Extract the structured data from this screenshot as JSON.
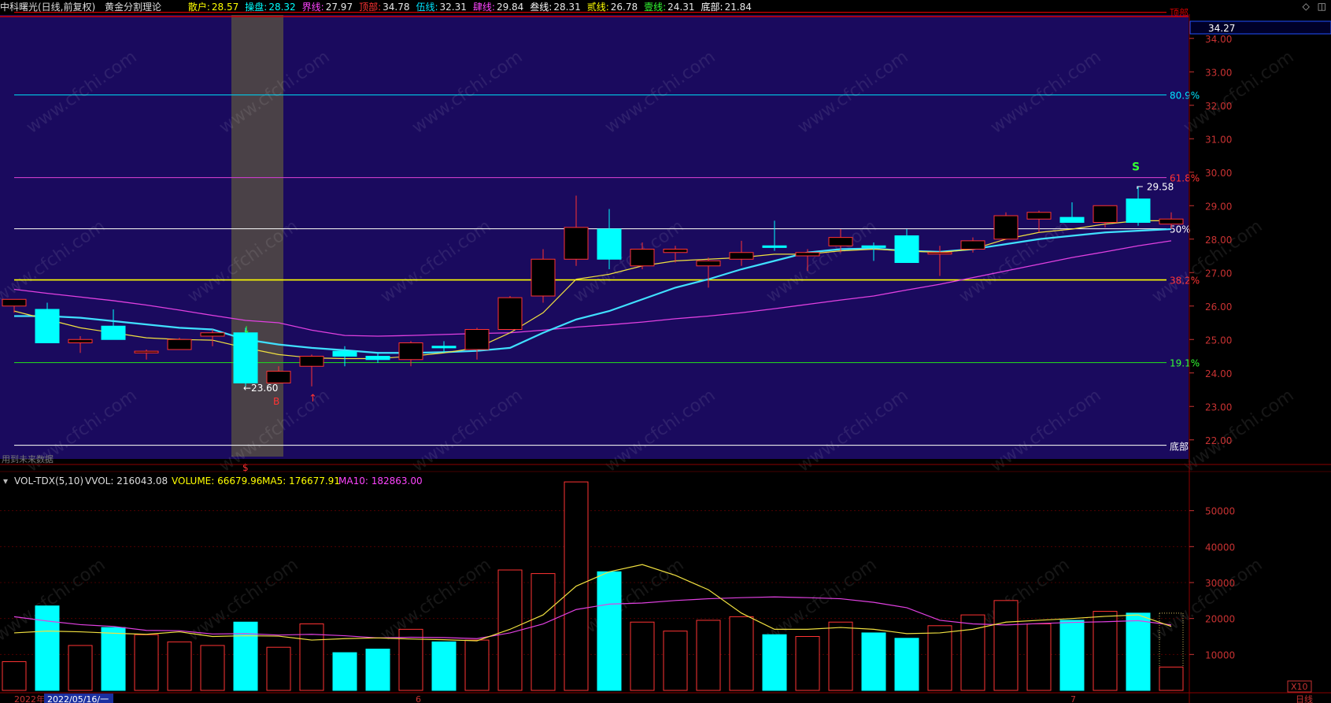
{
  "header": {
    "stock_name": "中科曙光(日线,前复权)",
    "indicator_name": "黄金分割理论",
    "params": [
      {
        "label": "散户:",
        "value": "28.57",
        "color": "#ffff00"
      },
      {
        "label": "操盘:",
        "value": "28.32",
        "color": "#00ffff"
      },
      {
        "label": "界线:",
        "value": "27.97",
        "color": "#ff44ff"
      },
      {
        "label": "顶部:",
        "value": "34.78",
        "color": "#ff3333"
      },
      {
        "label": "伍线:",
        "value": "32.31",
        "color": "#00e5ff"
      },
      {
        "label": "肆线:",
        "value": "29.84",
        "color": "#ff44ff"
      },
      {
        "label": "叁线:",
        "value": "28.31",
        "color": "#ffffff"
      },
      {
        "label": "贰线:",
        "value": "26.78",
        "color": "#ffff00"
      },
      {
        "label": "壹线:",
        "value": "24.31",
        "color": "#33ff33"
      },
      {
        "label": "底部:",
        "value": "21.84",
        "color": "#ffffff"
      }
    ],
    "top_right_icons": [
      "diamond-icon",
      "window-icon"
    ]
  },
  "price_axis": {
    "current": "34.27",
    "ticks": [
      "34.00",
      "33.00",
      "32.00",
      "31.00",
      "30.00",
      "29.00",
      "28.00",
      "27.00",
      "26.00",
      "25.00",
      "24.00",
      "23.00",
      "22.00"
    ]
  },
  "fib_levels": [
    {
      "label": "顶部",
      "price": 34.78,
      "color": "#d40000",
      "label_color": "#d40000"
    },
    {
      "label": "80.9%",
      "price": 32.31,
      "color": "#00c8e6",
      "label_color": "#00e5ff"
    },
    {
      "label": "61.8%",
      "price": 29.84,
      "color": "#c83cc8",
      "label_color": "#ff3333"
    },
    {
      "label": "50%",
      "price": 28.31,
      "color": "#e8e8e8",
      "label_color": "#ffffff"
    },
    {
      "label": "38.2%",
      "price": 26.78,
      "color": "#ffff00",
      "label_color": "#ff3333"
    },
    {
      "label": "19.1%",
      "price": 24.31,
      "color": "#22cc22",
      "label_color": "#33ff33"
    },
    {
      "label": "底部",
      "price": 21.84,
      "color": "#e8e8e8",
      "label_color": "#ffffff"
    }
  ],
  "chart_data": {
    "type": "candlestick",
    "price_range": [
      21.5,
      34.7
    ],
    "candles": [
      {
        "o": 26.0,
        "h": 26.2,
        "l": 25.8,
        "c": 26.2
      },
      {
        "o": 25.9,
        "h": 26.1,
        "l": 24.9,
        "c": 24.9
      },
      {
        "o": 24.9,
        "h": 25.1,
        "l": 24.6,
        "c": 25.0
      },
      {
        "o": 25.4,
        "h": 25.9,
        "l": 25.0,
        "c": 25.0
      },
      {
        "o": 24.6,
        "h": 24.7,
        "l": 24.4,
        "c": 24.65
      },
      {
        "o": 24.7,
        "h": 25.05,
        "l": 24.7,
        "c": 25.0
      },
      {
        "o": 25.1,
        "h": 25.3,
        "l": 24.8,
        "c": 25.2
      },
      {
        "o": 25.2,
        "h": 25.35,
        "l": 23.6,
        "c": 23.7
      },
      {
        "o": 23.7,
        "h": 24.2,
        "l": 23.7,
        "c": 24.05
      },
      {
        "o": 24.2,
        "h": 24.55,
        "l": 23.6,
        "c": 24.5
      },
      {
        "o": 24.65,
        "h": 24.8,
        "l": 24.2,
        "c": 24.5
      },
      {
        "o": 24.5,
        "h": 24.6,
        "l": 24.3,
        "c": 24.4
      },
      {
        "o": 24.4,
        "h": 24.95,
        "l": 24.2,
        "c": 24.9
      },
      {
        "o": 24.8,
        "h": 24.95,
        "l": 24.6,
        "c": 24.75
      },
      {
        "o": 24.7,
        "h": 25.35,
        "l": 24.4,
        "c": 25.3
      },
      {
        "o": 25.3,
        "h": 26.3,
        "l": 25.3,
        "c": 26.25
      },
      {
        "o": 26.3,
        "h": 27.7,
        "l": 26.1,
        "c": 27.4
      },
      {
        "o": 27.4,
        "h": 29.3,
        "l": 27.2,
        "c": 28.35
      },
      {
        "o": 28.3,
        "h": 28.9,
        "l": 27.1,
        "c": 27.4
      },
      {
        "o": 27.2,
        "h": 27.9,
        "l": 27.1,
        "c": 27.7
      },
      {
        "o": 27.6,
        "h": 27.8,
        "l": 27.3,
        "c": 27.7
      },
      {
        "o": 27.2,
        "h": 27.45,
        "l": 26.55,
        "c": 27.35
      },
      {
        "o": 27.4,
        "h": 27.95,
        "l": 27.2,
        "c": 27.6
      },
      {
        "o": 27.8,
        "h": 28.55,
        "l": 27.65,
        "c": 27.75
      },
      {
        "o": 27.5,
        "h": 27.7,
        "l": 27.05,
        "c": 27.6
      },
      {
        "o": 27.8,
        "h": 28.3,
        "l": 27.6,
        "c": 28.05
      },
      {
        "o": 27.8,
        "h": 27.9,
        "l": 27.35,
        "c": 27.75
      },
      {
        "o": 28.1,
        "h": 28.3,
        "l": 27.3,
        "c": 27.3
      },
      {
        "o": 27.6,
        "h": 27.8,
        "l": 26.9,
        "c": 27.6
      },
      {
        "o": 27.7,
        "h": 28.05,
        "l": 27.6,
        "c": 27.95
      },
      {
        "o": 28.0,
        "h": 28.8,
        "l": 28.0,
        "c": 28.7
      },
      {
        "o": 28.6,
        "h": 28.85,
        "l": 28.2,
        "c": 28.8
      },
      {
        "o": 28.65,
        "h": 29.1,
        "l": 28.5,
        "c": 28.5
      },
      {
        "o": 28.5,
        "h": 29.0,
        "l": 28.35,
        "c": 29.0
      },
      {
        "o": 29.2,
        "h": 29.58,
        "l": 28.4,
        "c": 28.5
      },
      {
        "o": 28.45,
        "h": 28.8,
        "l": 28.3,
        "c": 28.6
      }
    ],
    "ma_yellow": [
      25.85,
      25.6,
      25.35,
      25.2,
      25.05,
      25.0,
      24.98,
      24.75,
      24.55,
      24.45,
      24.43,
      24.43,
      24.5,
      24.6,
      24.75,
      25.2,
      25.8,
      26.8,
      26.95,
      27.2,
      27.35,
      27.4,
      27.45,
      27.55,
      27.55,
      27.65,
      27.7,
      27.65,
      27.6,
      27.7,
      28.0,
      28.2,
      28.3,
      28.45,
      28.55,
      28.55
    ],
    "ma_cyan": [
      25.7,
      25.7,
      25.65,
      25.55,
      25.45,
      25.35,
      25.3,
      25.0,
      24.85,
      24.75,
      24.68,
      24.6,
      24.6,
      24.62,
      24.66,
      24.75,
      25.2,
      25.6,
      25.85,
      26.2,
      26.55,
      26.8,
      27.1,
      27.35,
      27.6,
      27.7,
      27.72,
      27.65,
      27.62,
      27.7,
      27.85,
      28.0,
      28.1,
      28.2,
      28.25,
      28.3
    ],
    "ma_magenta": [
      26.5,
      26.38,
      26.27,
      26.16,
      26.03,
      25.88,
      25.72,
      25.57,
      25.5,
      25.28,
      25.12,
      25.1,
      25.12,
      25.15,
      25.18,
      25.2,
      25.28,
      25.37,
      25.44,
      25.52,
      25.62,
      25.7,
      25.8,
      25.92,
      26.05,
      26.18,
      26.3,
      26.48,
      26.65,
      26.85,
      27.05,
      27.25,
      27.45,
      27.62,
      27.8,
      27.95
    ],
    "volume": [
      8000,
      23500,
      12500,
      17500,
      15500,
      13500,
      12500,
      19000,
      12000,
      18500,
      10500,
      11500,
      17000,
      13500,
      14000,
      33500,
      32500,
      58000,
      33000,
      19000,
      16500,
      19500,
      20500,
      15500,
      15000,
      19000,
      16000,
      14500,
      18000,
      21000,
      25000,
      18500,
      19500,
      22000,
      21500,
      6500
    ],
    "vol_ma5": [
      16000,
      16500,
      16300,
      15900,
      15600,
      16300,
      15000,
      15200,
      15100,
      14000,
      14400,
      14600,
      14300,
      14100,
      13800,
      17000,
      21000,
      29000,
      33000,
      35000,
      32000,
      28000,
      21500,
      17000,
      17000,
      17500,
      17000,
      15800,
      16000,
      17000,
      19000,
      19500,
      20000,
      20600,
      21000,
      17800
    ],
    "vol_ma10": [
      20500,
      19300,
      18300,
      17800,
      16700,
      16600,
      15700,
      15800,
      15400,
      15600,
      15200,
      14600,
      14800,
      14700,
      14400,
      16000,
      18500,
      22500,
      24000,
      24300,
      25000,
      25500,
      25800,
      26000,
      25800,
      25500,
      24500,
      23000,
      19500,
      18500,
      18200,
      18600,
      18900,
      19100,
      19400,
      18200
    ],
    "vol_range": [
      0,
      60000
    ],
    "vol_ticks": [
      "50000",
      "40000",
      "30000",
      "20000",
      "10000"
    ]
  },
  "annotations": {
    "low_label": "←23.60",
    "high_label": "29.58",
    "s_signal": "S",
    "b_signal": "B",
    "bottom_marker": "$",
    "red_arrow": "↑",
    "green_arrow": "↓",
    "watermark": "www.cfchi.com",
    "no_data_text": "用到未来数据"
  },
  "volume_header": {
    "indicator": "VOL-TDX(5,10)",
    "vvol": "VVOL: 216043.08",
    "volume": "VOLUME: 66679.96",
    "ma5": "MA5: 176677.91",
    "ma10": "MA10: 182863.00"
  },
  "bottom_bar": {
    "year": "2022年",
    "date": "2022/05/16/一",
    "month6": "6",
    "month7": "7",
    "scale": "X10",
    "period": "日线"
  },
  "colors": {
    "background": "#000000",
    "price_bg": "#1a0a5e",
    "highlight": "#4a4147",
    "up": "#ff3333",
    "down": "#00ffff",
    "grid": "#8b0000",
    "axis_text": "#c83232"
  }
}
